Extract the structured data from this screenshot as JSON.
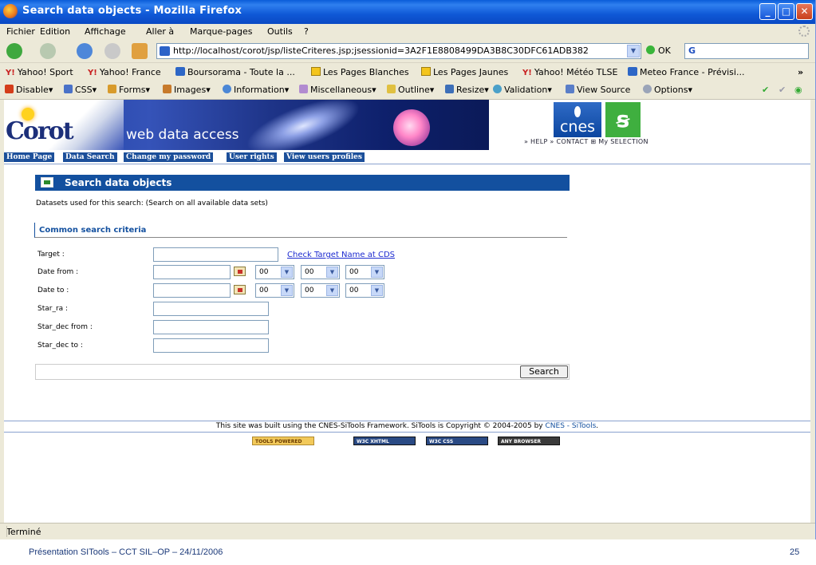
{
  "window": {
    "title": "Search data objects - Mozilla Firefox"
  },
  "menu": [
    "Fichier",
    "Edition",
    "Affichage",
    "Aller à",
    "Marque-pages",
    "Outils",
    "?"
  ],
  "nav": {
    "url": "http://localhost/corot/jsp/listeCriteres.jsp;jsessionid=3A2F1E8808499DA3B8C30DFC61ADB382",
    "ok_label": "OK",
    "search_prefix": "G"
  },
  "bookmarks": [
    "Yahoo! Sport",
    "Yahoo! France",
    "Boursorama - Toute la ...",
    "Les Pages Blanches",
    "Les Pages Jaunes",
    "Yahoo! Météo TLSE",
    "Meteo France - Prévisi...",
    "»"
  ],
  "devtools": [
    "Disable",
    "CSS",
    "Forms",
    "Images",
    "Information",
    "Miscellaneous",
    "Outline",
    "Resize",
    "Validation",
    "View Source",
    "Options"
  ],
  "banner": {
    "logo": "Corot",
    "tagline": "web data access",
    "cnes": "cnes",
    "toplinks": "» HELP » CONTACT ⊞ My SELECTION"
  },
  "pagenav": [
    "Home Page",
    "Data Search",
    "Change my password",
    "User rights",
    "View users profiles"
  ],
  "page": {
    "heading": "Search data objects",
    "datasets": "Datasets used for this search: (Search on all available data sets)",
    "criteria_title": "Common search criteria",
    "fields": [
      "Target :",
      "Date from :",
      "Date to :",
      "Star_ra :",
      "Star_dec from :",
      "Star_dec to :"
    ],
    "check_link": "Check Target Name at CDS",
    "time_value": "00",
    "search_button": "Search"
  },
  "footer": {
    "text": "This site was built using the CNES-SiTools Framework. SiTools is Copyright © 2004-2005 by",
    "link": "CNES - SiTools",
    "period": ".",
    "badges": [
      "TOOLS POWERED",
      "W3C XHTML",
      "W3C CSS",
      "ANY BROWSER"
    ]
  },
  "status": "Terminé",
  "slide": {
    "caption": "Présentation SITools – CCT SIL–OP – 24/11/2006",
    "page": "25"
  }
}
